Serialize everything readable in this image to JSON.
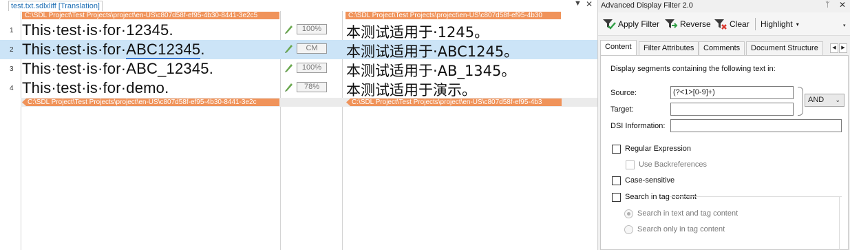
{
  "editor": {
    "tab_label": "test.txt.sdlxliff [Translation]",
    "dropdown_glyph": "▼",
    "close_glyph": "✕",
    "file_tag_text": "C:\\SDL Project\\Test Projects\\project\\en-US\\c807d58f-ef95-4b30-8441-3e2c5",
    "file_tag_text_target": "C:\\SDL Project\\Test Projects\\project\\en-US\\c807d58f-ef95-4b30",
    "file_tag_end_text": "C:\\SDL Project\\Test Projects\\project\\en-US\\c807d58f-ef95-4b30-8441-3e2c",
    "file_tag_end_text_target": "C:\\SDL Project\\Test Projects\\project\\en-US\\c807d58f-ef95-4b3",
    "rows": [
      {
        "num": "1",
        "src": "This·test·is·for·12345.",
        "match": "100%",
        "tgt": "本测试适用于·1245。"
      },
      {
        "num": "2",
        "src_a": "This·test·is·for·",
        "src_u": "ABC12345",
        "src_b": ".",
        "match": "CM",
        "tgt": "本测试适用于·ABC1245。"
      },
      {
        "num": "3",
        "src": "This·test·is·for·ABC_12345.",
        "match": "100%",
        "tgt": "本测试适用于·AB_1345。"
      },
      {
        "num": "4",
        "src": "This·test·is·for·demo.",
        "match": "78%",
        "tgt": "本测试适用于演示。"
      }
    ],
    "status_icon": "pencil-check-icon"
  },
  "panel": {
    "title": "Advanced Display Filter 2.0",
    "pin_glyph": "ᛘ",
    "close_glyph": "✕",
    "toolbar": {
      "apply_filter": "Apply Filter",
      "reverse": "Reverse",
      "clear": "Clear",
      "highlight": "Highlight",
      "caret": "▾",
      "overflow_glyph": "▾"
    },
    "tabs": [
      "Content",
      "Filter Attributes",
      "Comments",
      "Document Structure"
    ],
    "tab_scroll_left": "◀",
    "tab_scroll_right": "▶",
    "content": {
      "intro": "Display segments containing the following text in:",
      "source_label": "Source:",
      "source_value": "(?<1>[0-9]+)",
      "target_label": "Target:",
      "target_value": "",
      "dsi_label": "DSI Information:",
      "dsi_value": "",
      "operator": "AND",
      "operator_caret": "⌄",
      "regex_label": "Regular Expression",
      "backref_label": "Use Backreferences",
      "case_label": "Case-sensitive",
      "tag_label": "Search in tag content",
      "radio_text_tag": "Search in text and tag content",
      "radio_tag_only": "Search only in tag content"
    }
  },
  "colors": {
    "selection": "#cce4f7",
    "file_tag": "#f0935a",
    "tab_link": "#1f6fb5"
  }
}
